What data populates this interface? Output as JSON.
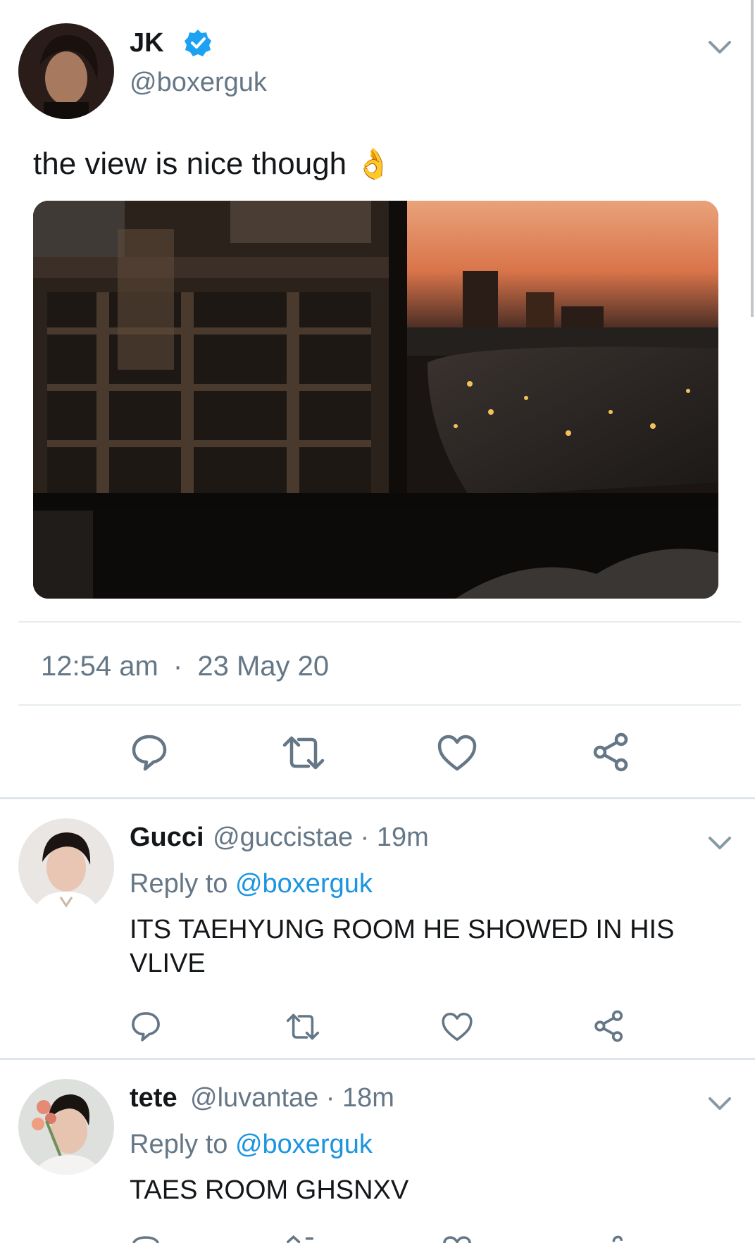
{
  "main_tweet": {
    "name": "JK",
    "handle": "@boxerguk",
    "text": "the view is nice though",
    "emoji": "👌",
    "time": "12:54 am",
    "separator": "·",
    "date": "23 May 20"
  },
  "replies": [
    {
      "name": "Gucci",
      "handle": "@guccistae",
      "age": "· 19m",
      "reply_prefix": "Reply to",
      "reply_handle": "@boxerguk",
      "text": "ITS TAEHYUNG ROOM HE SHOWED IN HIS VLIVE"
    },
    {
      "name": "tete",
      "handle": "@luvantae",
      "age": "· 18m",
      "reply_prefix": "Reply to",
      "reply_handle": "@boxerguk",
      "text": "TAES ROOM GHSNXV"
    }
  ],
  "colors": {
    "accent": "#1b95e0",
    "secondary_text": "#657786",
    "icon": "#657786",
    "divider": "#e6ecf0"
  },
  "icons": [
    "verified-badge-icon",
    "chevron-down-icon",
    "reply-icon",
    "retweet-icon",
    "like-icon",
    "share-icon"
  ]
}
